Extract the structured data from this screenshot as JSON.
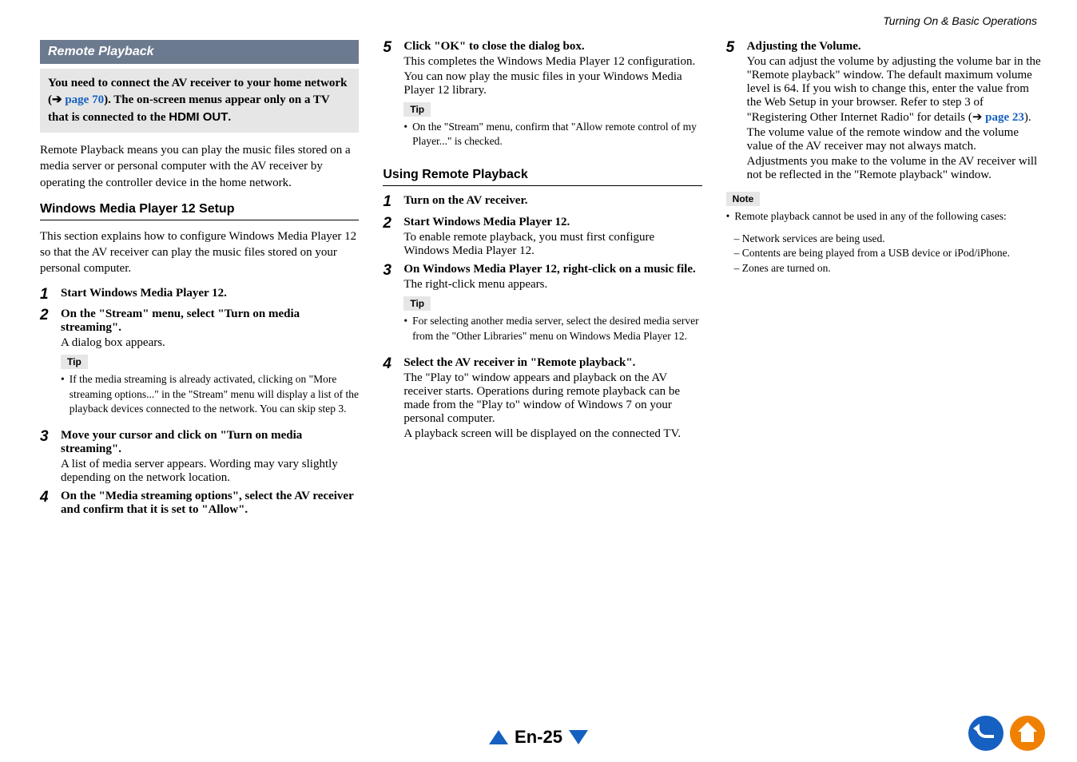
{
  "header": {
    "section": "Turning On & Basic Operations"
  },
  "col1": {
    "band": "Remote Playback",
    "info": {
      "pre": "You need to connect the AV receiver to your home network (",
      "arrow": "➔",
      "link": " page 70",
      "post": "). The on-screen menus appear only on a TV that is connected to the ",
      "sans": "HDMI OUT",
      "end": "."
    },
    "intro": "Remote Playback means you can play the music files stored on a media server or personal computer with the AV receiver by operating the controller device in the home network.",
    "h2": "Windows Media Player 12 Setup",
    "desc": "This section explains how to configure Windows Media Player 12 so that the AV receiver can play the music files stored on your personal computer.",
    "steps": [
      {
        "n": "1",
        "title": "Start Windows Media Player 12."
      },
      {
        "n": "2",
        "title": "On the \"Stream\" menu, select \"Turn on media streaming\".",
        "text": "A dialog box appears.",
        "tipLabel": "Tip",
        "tip": "If the media streaming is already activated, clicking on \"More streaming options...\" in the \"Stream\" menu will display a list of the playback devices connected to the network. You can skip step 3."
      },
      {
        "n": "3",
        "title": "Move your cursor and click on \"Turn on media streaming\".",
        "text": "A list of media server appears. Wording may vary slightly depending on the network location."
      },
      {
        "n": "4",
        "title": "On the \"Media streaming options\", select the AV receiver and confirm that it is set to \"Allow\"."
      }
    ]
  },
  "col2": {
    "step5": {
      "n": "5",
      "title": "Click \"OK\" to close the dialog box.",
      "text1": "This completes the Windows Media Player 12 configuration.",
      "text2": "You can now play the music files in your Windows Media Player 12 library.",
      "tipLabel": "Tip",
      "tip": "On the \"Stream\" menu, confirm that \"Allow remote control of my Player...\" is checked."
    },
    "h2": "Using Remote Playback",
    "steps": [
      {
        "n": "1",
        "title": "Turn on the AV receiver."
      },
      {
        "n": "2",
        "title": "Start Windows Media Player 12.",
        "text": "To enable remote playback, you must first configure Windows Media Player 12."
      },
      {
        "n": "3",
        "title": "On Windows Media Player 12, right-click on a music file.",
        "text": "The right-click menu appears.",
        "tipLabel": "Tip",
        "tip": "For selecting another media server, select the desired media server from the \"Other Libraries\" menu on Windows Media Player 12."
      },
      {
        "n": "4",
        "title": "Select the AV receiver in \"Remote playback\".",
        "text": "The \"Play to\" window appears and playback on the AV receiver starts. Operations during remote playback can be made from the \"Play to\" window of Windows 7 on your personal computer.",
        "text2": "A playback screen will be displayed on the connected TV."
      }
    ]
  },
  "col3": {
    "step5": {
      "n": "5",
      "title": "Adjusting the Volume.",
      "text1_pre": "You can adjust the volume by adjusting the volume bar in the \"Remote playback\" window. The default maximum volume level is 64. If you wish to change this, enter the value from the Web Setup in your browser. Refer to step 3 of \"Registering Other Internet Radio\" for details (",
      "arrow": "➔",
      "link": " page 23",
      "text1_post": ").",
      "text2": "The volume value of the remote window and the volume value of the AV receiver may not always match.",
      "text3": "Adjustments you make to the volume in the AV receiver will not be reflected in the \"Remote playback\" window."
    },
    "noteLabel": "Note",
    "noteBullet": "Remote playback cannot be used in any of the following cases:",
    "noteItems": [
      "Network services are being used.",
      "Contents are being played from a USB device or iPod/iPhone.",
      "Zones are turned on."
    ]
  },
  "footer": {
    "page": "En-25"
  }
}
